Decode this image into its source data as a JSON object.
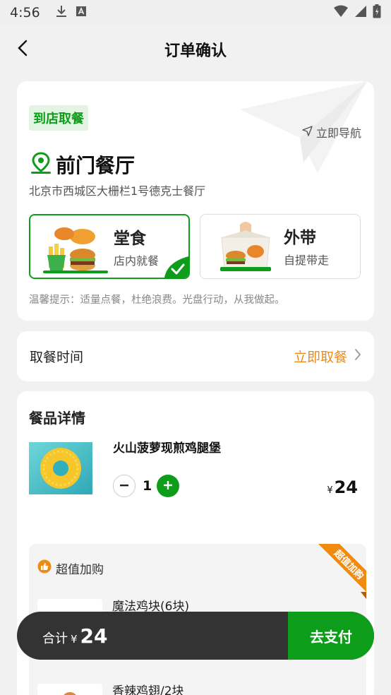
{
  "status_bar": {
    "time": "4:56"
  },
  "header": {
    "title": "订单确认"
  },
  "store": {
    "mode_tag": "到店取餐",
    "navigate_label": "立即导航",
    "name": "前门餐厅",
    "address": "北京市西城区大栅栏1号德克士餐厅",
    "options": [
      {
        "title": "堂食",
        "subtitle": "店内就餐",
        "selected": true
      },
      {
        "title": "外带",
        "subtitle": "自提带走",
        "selected": false
      }
    ],
    "tip": "温馨提示：适量点餐，杜绝浪费。光盘行动，从我做起。"
  },
  "pickup": {
    "label": "取餐时间",
    "value": "立即取餐"
  },
  "items": {
    "title": "餐品详情",
    "list": [
      {
        "name": "火山菠萝现煎鸡腿堡",
        "quantity": "1",
        "currency": "¥",
        "price": "24"
      }
    ]
  },
  "upsell": {
    "title": "超值加购",
    "ribbon": "超值加购",
    "items": [
      {
        "name": "魔法鸡块(6块)"
      },
      {
        "name": "香辣鸡翅/2块"
      }
    ]
  },
  "footer": {
    "total_label": "合计",
    "currency": "¥",
    "total": "24",
    "pay_label": "去支付"
  },
  "colors": {
    "brand_green": "#0e9d1a",
    "accent_orange": "#f08a10",
    "bar_dark": "#333333"
  }
}
